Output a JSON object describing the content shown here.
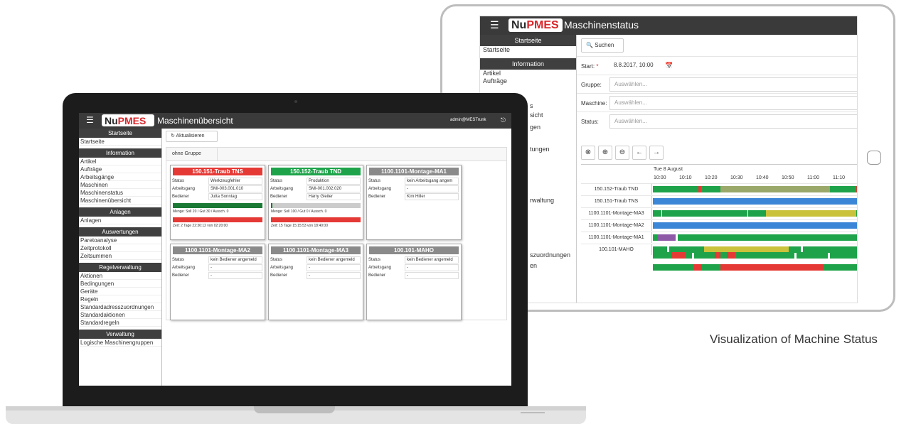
{
  "tablet": {
    "logo": {
      "nu": "Nu",
      "pmes": "PMES"
    },
    "title": "Maschinenstatus",
    "sidebar": {
      "group_startseite": "Startseite",
      "item_startseite": "Startseite",
      "group_information": "Information",
      "items_information": [
        "Artikel",
        "Aufträge"
      ],
      "partial_1": "s",
      "partial_2": "sicht",
      "partial_3": "gen",
      "partial_4": "tungen",
      "partial_5": "rwaltung",
      "partial_6": "szuordnungen",
      "partial_7": "en"
    },
    "search_label": "Suchen",
    "form": {
      "start_label": "Start:",
      "start_required": "*",
      "start_value": "8.8.2017, 10:00",
      "gruppe_label": "Gruppe:",
      "gruppe_placeholder": "Auswählen...",
      "maschine_label": "Maschine:",
      "maschine_placeholder": "Auswählen...",
      "status_label": "Status:",
      "status_placeholder": "Auswählen..."
    },
    "timeline": {
      "date": "Tue 8 August",
      "ticks": [
        "10:00",
        "10:10",
        "10:20",
        "10:30",
        "10:40",
        "10:50",
        "11:00",
        "11:10"
      ],
      "colors": {
        "green": "#1ea34a",
        "red": "#e53935",
        "olive": "#9aa86a",
        "yellow": "#c9c23a",
        "blue": "#3b86d6",
        "purple": "#8e5aa8"
      },
      "rows": [
        {
          "name": "150.152-Traub TND",
          "segments": [
            {
              "s": 0,
              "e": 0.22,
              "c": "green"
            },
            {
              "s": 0.22,
              "e": 0.235,
              "c": "red"
            },
            {
              "s": 0.235,
              "e": 0.33,
              "c": "green"
            },
            {
              "s": 0.33,
              "e": 0.86,
              "c": "olive"
            },
            {
              "s": 0.86,
              "e": 0.99,
              "c": "green"
            },
            {
              "s": 0.99,
              "e": 1,
              "c": "red"
            }
          ]
        },
        {
          "name": "150.151-Traub TNS",
          "segments": [
            {
              "s": 0,
              "e": 1,
              "c": "blue"
            }
          ]
        },
        {
          "name": "1100.1101-Montage-MA3",
          "segments": [
            {
              "s": 0,
              "e": 0.04,
              "c": "green"
            },
            {
              "s": 0.045,
              "e": 0.46,
              "c": "green"
            },
            {
              "s": 0.465,
              "e": 0.55,
              "c": "green"
            },
            {
              "s": 0.55,
              "e": 0.99,
              "c": "yellow"
            },
            {
              "s": 0.99,
              "e": 1,
              "c": "green"
            }
          ]
        },
        {
          "name": "1100.1101-Montage-MA2",
          "segments": [
            {
              "s": 0,
              "e": 1,
              "c": "blue"
            }
          ]
        },
        {
          "name": "1100.1101-Montage-MA1",
          "segments": [
            {
              "s": 0,
              "e": 0.02,
              "c": "green"
            },
            {
              "s": 0.02,
              "e": 0.11,
              "c": "purple"
            },
            {
              "s": 0.12,
              "e": 1,
              "c": "green"
            }
          ]
        },
        {
          "name": "100.101-MAHO",
          "segments": [
            {
              "s": 0,
              "e": 0.07,
              "c": "green"
            },
            {
              "s": 0.08,
              "e": 0.25,
              "c": "green"
            },
            {
              "s": 0.25,
              "e": 0.66,
              "c": "yellow"
            },
            {
              "s": 0.66,
              "e": 0.72,
              "c": "green"
            },
            {
              "s": 0.73,
              "e": 1,
              "c": "green"
            }
          ]
        }
      ]
    },
    "extra_rows": [
      [
        {
          "s": 0,
          "e": 0.09,
          "c": "green"
        },
        {
          "s": 0.09,
          "e": 0.16,
          "c": "red"
        },
        {
          "s": 0.16,
          "e": 0.19,
          "c": "green"
        },
        {
          "s": 0.2,
          "e": 0.3,
          "c": "green"
        },
        {
          "s": 0.3,
          "e": 0.33,
          "c": "red"
        },
        {
          "s": 0.33,
          "e": 0.36,
          "c": "green"
        },
        {
          "s": 0.36,
          "e": 0.4,
          "c": "red"
        },
        {
          "s": 0.4,
          "e": 0.42,
          "c": "green"
        },
        {
          "s": 0.42,
          "e": 0.69,
          "c": "green"
        },
        {
          "s": 0.7,
          "e": 0.85,
          "c": "green"
        },
        {
          "s": 0.86,
          "e": 1,
          "c": "green"
        }
      ],
      [
        {
          "s": 0,
          "e": 0.2,
          "c": "green"
        },
        {
          "s": 0.2,
          "e": 0.24,
          "c": "red"
        },
        {
          "s": 0.24,
          "e": 0.33,
          "c": "green"
        },
        {
          "s": 0.33,
          "e": 0.42,
          "c": "red"
        },
        {
          "s": 0.42,
          "e": 0.83,
          "c": "red"
        },
        {
          "s": 0.83,
          "e": 1,
          "c": "green"
        }
      ]
    ]
  },
  "caption": "Visualization of Machine Status",
  "laptop": {
    "logo": {
      "nu": "Nu",
      "pmes": "PMES"
    },
    "title": "Maschinenübersicht",
    "user": "admin@MESTrunk",
    "refresh_label": "Aktualisieren",
    "tab_label": "ohne Gruppe",
    "sidebar": [
      {
        "group": "Startseite",
        "items": [
          "Startseite"
        ]
      },
      {
        "group": "Information",
        "items": [
          "Artikel",
          "Aufträge",
          "Arbeitsgänge",
          "Maschinen",
          "Maschinenstatus",
          "Maschinenübersicht"
        ]
      },
      {
        "group": "Anlagen",
        "items": [
          "Anlagen"
        ]
      },
      {
        "group": "Auswertungen",
        "items": [
          "Paretoanalyse",
          "Zeitprotokoll",
          "Zeitsummen"
        ]
      },
      {
        "group": "Regelverwaltung",
        "items": [
          "Aktionen",
          "Bedingungen",
          "Geräte",
          "Regeln",
          "Standardadresszuordnungen",
          "Standardaktionen",
          "Standardregeln"
        ]
      },
      {
        "group": "Verwaltung",
        "items": [
          "Logische Maschinengruppen"
        ]
      }
    ],
    "cards": [
      {
        "title": "150.151-Traub TNS",
        "color": "red",
        "status_label": "Status",
        "status": "Werkzeugfehler",
        "ag_label": "Arbeitsgang",
        "ag": "SMI-003.001.010",
        "bed_label": "Bediener",
        "bed": "Jutta Sonntag",
        "bar1": "#1a7a35",
        "menge": "Menge: Soll 20 / Gut 30 / Aussch. 0",
        "bar2": "#e53935",
        "zeit": "Zeit: 2 Tage 22:36:12 von 02:20:00"
      },
      {
        "title": "150.152-Traub TND",
        "color": "green",
        "status_label": "Status",
        "status": "Produktion",
        "ag_label": "Arbeitsgang",
        "ag": "SMI-001.002.020",
        "bed_label": "Bediener",
        "bed": "Harry Gleiter",
        "bar1": "#cccccc",
        "menge": "Menge: Soll 100 / Gut 0 / Aussch. 0",
        "bar2": "#e53935",
        "zeit": "Zeit: 15 Tage 15:15:53 von 18:40:00"
      },
      {
        "title": "1100.1101-Montage-MA1",
        "color": "gray",
        "status_label": "Status",
        "status": "kein Arbeitsgang angem",
        "ag_label": "Arbeitsgang",
        "ag": "-",
        "bed_label": "Bediener",
        "bed": "Kim Hiller"
      },
      {
        "title": "1100.1101-Montage-MA2",
        "color": "gray",
        "status_label": "Status",
        "status": "kein Bediener angemeld",
        "ag_label": "Arbeitsgang",
        "ag": "-",
        "bed_label": "Bediener",
        "bed": "-"
      },
      {
        "title": "1100.1101-Montage-MA3",
        "color": "gray",
        "status_label": "Status",
        "status": "kein Bediener angemeld",
        "ag_label": "Arbeitsgang",
        "ag": "-",
        "bed_label": "Bediener",
        "bed": "-"
      },
      {
        "title": "100.101-MAHO",
        "color": "gray",
        "status_label": "Status",
        "status": "kein Bediener angemeld",
        "ag_label": "Arbeitsgang",
        "ag": "-",
        "bed_label": "Bediener",
        "bed": "-"
      }
    ]
  }
}
